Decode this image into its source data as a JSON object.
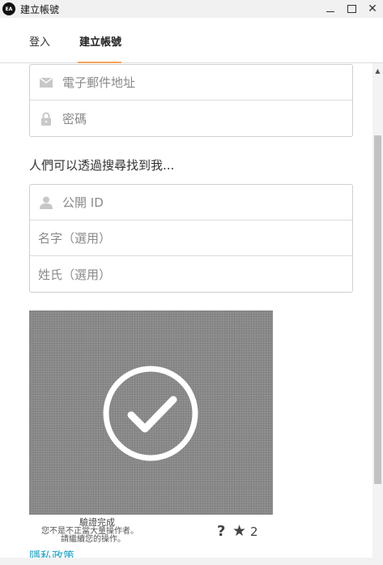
{
  "window": {
    "logo_text": "EA",
    "title": "建立帳號",
    "controls": {
      "minimize": "minimize-icon",
      "maximize": "maximize-icon",
      "close": "✕"
    }
  },
  "tabs": [
    {
      "label": "登入",
      "active": false
    },
    {
      "label": "建立帳號",
      "active": true
    }
  ],
  "accent_color": "#f7a35c",
  "link_color": "#1ba1c9",
  "account_fields": [
    {
      "icon": "envelope-icon",
      "placeholder": "電子郵件地址"
    },
    {
      "icon": "lock-icon",
      "placeholder": "密碼"
    }
  ],
  "profile_section_label": "人們可以透過搜尋找到我...",
  "profile_fields": [
    {
      "icon": "person-icon",
      "placeholder": "公開 ID"
    },
    {
      "icon": "",
      "placeholder": "名字（選用）"
    },
    {
      "icon": "",
      "placeholder": "姓氏（選用）"
    }
  ],
  "captcha": {
    "status": "驗證完成",
    "message_line1": "您不是不正當大量操作者。",
    "message_line2": "請繼續您的操作。",
    "help_symbol": "?",
    "star_symbol": "★",
    "count": "2"
  },
  "privacy_link": "隱私政策"
}
